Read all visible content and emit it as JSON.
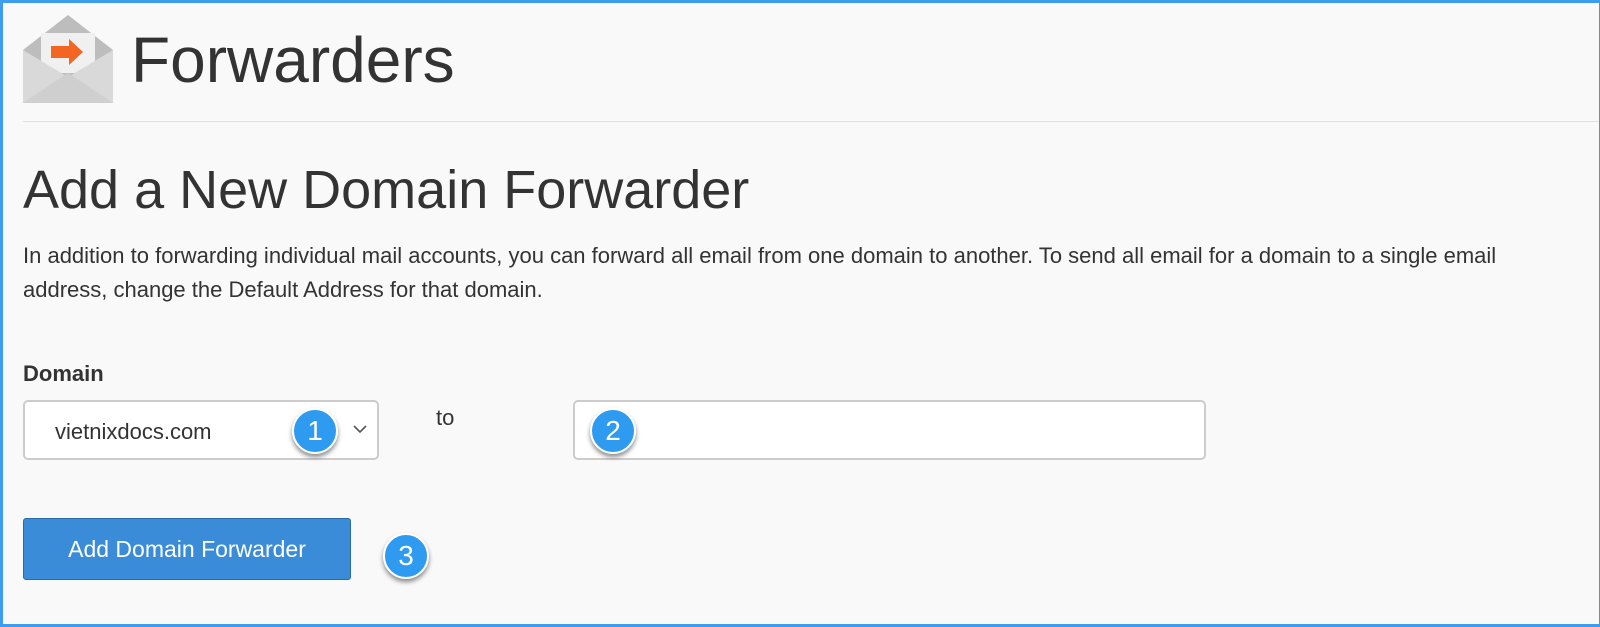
{
  "header": {
    "title": "Forwarders",
    "icon": "mail-forward-envelope-icon"
  },
  "section": {
    "title": "Add a New Domain Forwarder",
    "description": "In addition to forwarding individual mail accounts, you can forward all email from one domain to another. To send all email for a domain to a single email address, change the Default Address for that domain."
  },
  "form": {
    "domain_label": "Domain",
    "domain_selected": "vietnixdocs.com",
    "to_label": "to",
    "target_value": "",
    "submit_label": "Add Domain Forwarder"
  },
  "annotations": [
    "1",
    "2",
    "3"
  ],
  "colors": {
    "accent_blue": "#3a8cd8",
    "badge_blue": "#2f9bf0",
    "icon_orange": "#f26522",
    "frame_border": "#3d9bf0"
  }
}
